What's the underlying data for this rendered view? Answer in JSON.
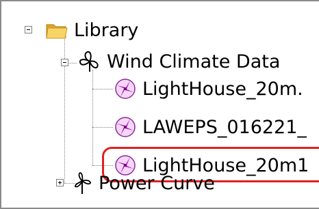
{
  "tree": {
    "root": {
      "label": "Library",
      "icon": "folder-icon",
      "expanded": true,
      "children": [
        {
          "label": "Wind Climate Data",
          "icon": "wind-climate-icon",
          "expanded": true,
          "children": [
            {
              "label": "LightHouse_20m.",
              "icon": "wind-rose-icon"
            },
            {
              "label": "LAWEPS_016221_",
              "icon": "wind-rose-icon"
            },
            {
              "label": "LightHouse_20m1",
              "icon": "wind-rose-icon",
              "highlighted": true
            }
          ]
        },
        {
          "label": "Power Curve",
          "icon": "turbine-icon",
          "expanded": false
        }
      ]
    }
  },
  "colors": {
    "highlight": "#e02020",
    "folder": "#f2c84b",
    "wind_rose": "#b000c0"
  }
}
